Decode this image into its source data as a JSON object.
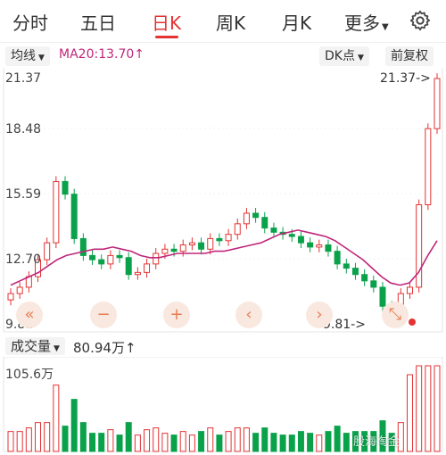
{
  "tabs": [
    {
      "label": "分时",
      "active": false
    },
    {
      "label": "五日",
      "active": false
    },
    {
      "label": "日K",
      "active": true
    },
    {
      "label": "周K",
      "active": false
    },
    {
      "label": "月K",
      "active": false
    },
    {
      "label": "更多",
      "active": false
    }
  ],
  "toolbar": {
    "indicator": "均线",
    "ma_text": "MA20:13.70↑",
    "dk_label": "DK点",
    "adjust_label": "前复权"
  },
  "axis": {
    "y_ticks": [
      "21.37",
      "18.48",
      "15.59",
      "12.70",
      "9.81"
    ],
    "max_label": "21.37->",
    "min_label": "9.81->"
  },
  "volume": {
    "title": "成交量",
    "value": "80.94万↑",
    "max_label": "105.6万"
  },
  "watermark": "股海淘金",
  "colors": {
    "up": "#e33333",
    "down": "#0aa14b",
    "ma": "#c0267a",
    "accent": "#e77d52"
  },
  "chart_data": {
    "type": "candlestick",
    "title": "",
    "ylim": [
      9.81,
      21.37
    ],
    "y_ticks": [
      21.37,
      18.48,
      15.59,
      12.7,
      9.81
    ],
    "series": [
      {
        "name": "MA20",
        "values": [
          11.6,
          11.8,
          12.0,
          12.2,
          12.5,
          12.8,
          13.0,
          13.1,
          13.2,
          13.3,
          13.3,
          13.4,
          13.3,
          13.2,
          13.0,
          12.9,
          12.9,
          13.0,
          13.1,
          13.1,
          13.1,
          13.1,
          13.2,
          13.2,
          13.3,
          13.4,
          13.5,
          13.6,
          13.8,
          14.0,
          14.1,
          14.2,
          14.1,
          14.0,
          13.9,
          13.7,
          13.4,
          13.1,
          12.8,
          12.4,
          12.0,
          11.7,
          11.6,
          11.7,
          12.2,
          13.0,
          13.7
        ]
      },
      {
        "name": "daily_close",
        "values": [
          11.2,
          11.5,
          12.0,
          12.8,
          13.6,
          16.5,
          15.9,
          13.8,
          13.0,
          12.8,
          12.6,
          13.0,
          12.9,
          12.1,
          12.2,
          12.6,
          13.1,
          13.3,
          13.2,
          13.5,
          13.6,
          13.3,
          13.8,
          13.7,
          14.0,
          14.5,
          15.0,
          14.8,
          14.3,
          14.1,
          14.0,
          13.9,
          13.6,
          13.4,
          13.5,
          13.2,
          12.6,
          12.4,
          12.1,
          11.8,
          11.5,
          10.6,
          10.4,
          11.2,
          11.5,
          15.4,
          19.0,
          21.37
        ]
      }
    ],
    "volume_ylim": [
      0,
      105.6
    ],
    "volume_unit": "万"
  }
}
